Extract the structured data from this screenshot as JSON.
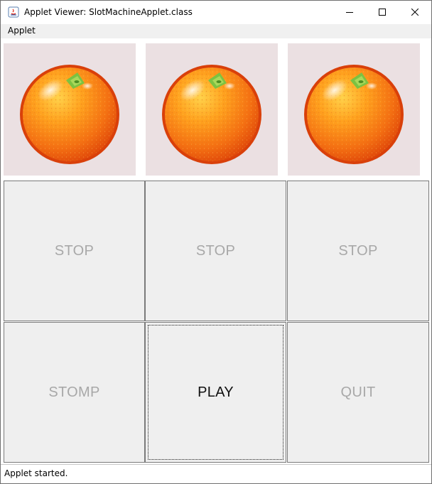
{
  "window": {
    "title": "Applet Viewer: SlotMachineApplet.class",
    "app_icon": "java-icon",
    "controls": [
      "minimize-icon",
      "maximize-icon",
      "close-icon"
    ]
  },
  "menubar": {
    "items": [
      {
        "label": "Applet"
      }
    ]
  },
  "reels": [
    {
      "symbol": "orange"
    },
    {
      "symbol": "orange"
    },
    {
      "symbol": "orange"
    }
  ],
  "buttons": {
    "stop_1": {
      "label": "STOP",
      "enabled": false
    },
    "stop_2": {
      "label": "STOP",
      "enabled": false
    },
    "stop_3": {
      "label": "STOP",
      "enabled": false
    },
    "stomp": {
      "label": "STOMP",
      "enabled": false
    },
    "play": {
      "label": "PLAY",
      "enabled": true,
      "focused": true
    },
    "quit": {
      "label": "QUIT",
      "enabled": false
    }
  },
  "status": {
    "text": "Applet started."
  },
  "colors": {
    "reel_background": "#ebe0e2",
    "button_face": "#efefef",
    "disabled_text": "#a8a8a8",
    "orange": "#f57c1f"
  }
}
